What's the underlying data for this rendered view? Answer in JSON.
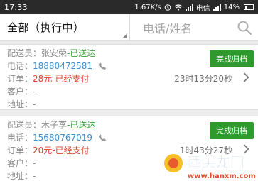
{
  "status_bar": {
    "time": "17:33",
    "speed": "1.67K/s",
    "carrier": "电信",
    "battery": "14%"
  },
  "filter": {
    "selected": "全部（执行中）",
    "search_placeholder": "电话/姓名"
  },
  "orders": [
    {
      "courier_label": "配送员：",
      "courier_name": "张安荣",
      "delivery_status": "-已送达",
      "phone_label": "电话：",
      "phone": "18880472581",
      "order_label": "订单：",
      "amount": "28元",
      "payment_status": "-已经支付",
      "customer_label": "客户：",
      "customer": "-",
      "address_label": "地址：",
      "address": "-",
      "timer": "23时13分20秒",
      "button_label": "完成归档"
    },
    {
      "courier_label": "配送员：",
      "courier_name": "木子李",
      "delivery_status": "-已送达",
      "phone_label": "电话：",
      "phone": "15680767019",
      "order_label": "订单：",
      "amount": "20元",
      "payment_status": "-已经支付",
      "customer_label": "客户：",
      "customer": "-",
      "address_label": "地址：",
      "address": "-",
      "timer": "1时43分27秒",
      "button_label": "完成归档"
    }
  ],
  "watermark": {
    "text": "西美龙网",
    "url": "www.hanxm.com"
  },
  "colors": {
    "accent_green": "#2e9a2e",
    "phone_blue": "#3d8fd1",
    "amount_red": "#e0402e"
  }
}
